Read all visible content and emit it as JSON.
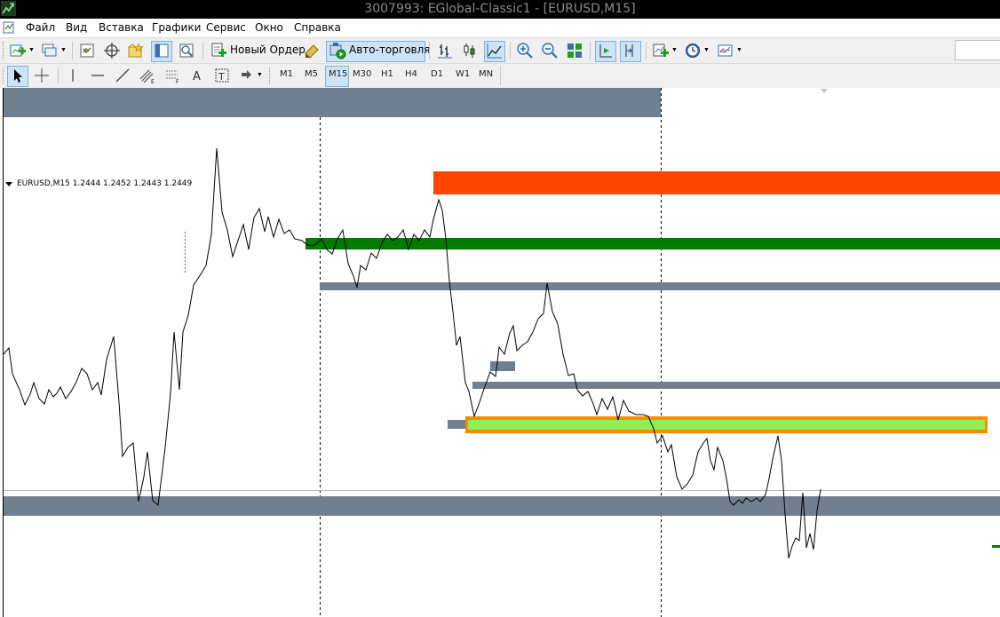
{
  "window": {
    "title": "3007993: EGlobal-Classic1 - [EURUSD,M15]"
  },
  "menu": [
    "Файл",
    "Вид",
    "Вставка",
    "Графики",
    "Сервис",
    "Окно",
    "Справка"
  ],
  "toolbar": {
    "new_order_label": "Новый Ордер",
    "autotrading_label": "Авто-торговля"
  },
  "timeframes": [
    "M1",
    "M5",
    "M15",
    "M30",
    "H1",
    "H4",
    "D1",
    "W1",
    "MN"
  ],
  "active_timeframe": "M15",
  "chart": {
    "info": "EURUSD,M15  1.2444 1.2452 1.2443 1.2449",
    "symbol": "EURUSD",
    "timeframe": "M15",
    "ohlc": {
      "open": 1.2444,
      "high": 1.2452,
      "low": 1.2443,
      "close": 1.2449
    },
    "colors": {
      "supply_zone": "#ff4500",
      "green_level": "#007a00",
      "grey_level": "#708090",
      "lime_zone": "#90ee58",
      "orange_border": "#ff8c00",
      "price_line": "#000000"
    }
  }
}
